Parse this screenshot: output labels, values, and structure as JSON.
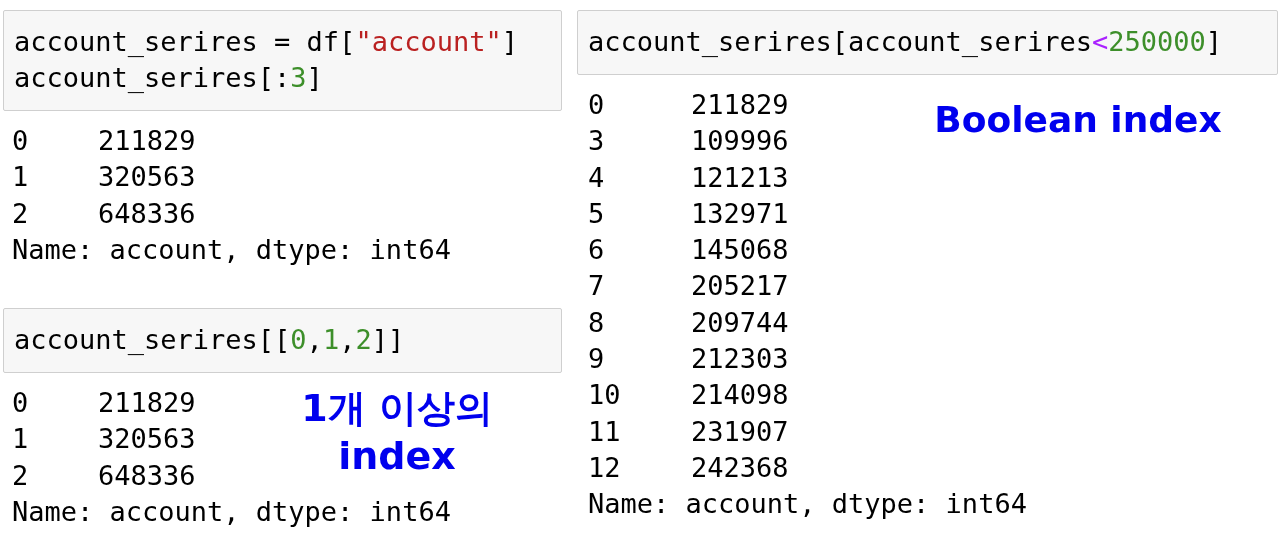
{
  "columns": [
    {
      "cells": [
        {
          "code": [
            [
              {
                "kind": "plain",
                "text": "account_serires = df["
              },
              {
                "kind": "string",
                "text": "\"account\""
              },
              {
                "kind": "plain",
                "text": "]"
              }
            ],
            [
              {
                "kind": "plain",
                "text": "account_serires[:"
              },
              {
                "kind": "number",
                "text": "3"
              },
              {
                "kind": "plain",
                "text": "]"
              }
            ]
          ],
          "output": {
            "rows": [
              {
                "index": "0",
                "value": "211829"
              },
              {
                "index": "1",
                "value": "320563"
              },
              {
                "index": "2",
                "value": "648336"
              }
            ],
            "footer": "Name: account, dtype: int64"
          }
        },
        {
          "code": [
            [
              {
                "kind": "plain",
                "text": "account_serires[["
              },
              {
                "kind": "number",
                "text": "0"
              },
              {
                "kind": "plain",
                "text": ","
              },
              {
                "kind": "number",
                "text": "1"
              },
              {
                "kind": "plain",
                "text": ","
              },
              {
                "kind": "number",
                "text": "2"
              },
              {
                "kind": "plain",
                "text": "]]"
              }
            ]
          ],
          "output": {
            "rows": [
              {
                "index": "0",
                "value": "211829"
              },
              {
                "index": "1",
                "value": "320563"
              },
              {
                "index": "2",
                "value": "648336"
              }
            ],
            "footer": "Name: account, dtype: int64"
          },
          "annotation": "1개 이상의 index"
        }
      ]
    },
    {
      "cells": [
        {
          "code": [
            [
              {
                "kind": "plain",
                "text": "account_serires[account_serires"
              },
              {
                "kind": "operator",
                "text": "<"
              },
              {
                "kind": "number",
                "text": "250000"
              },
              {
                "kind": "plain",
                "text": "]"
              }
            ]
          ],
          "output": {
            "rows": [
              {
                "index": "0",
                "value": "211829"
              },
              {
                "index": "3",
                "value": "109996"
              },
              {
                "index": "4",
                "value": "121213"
              },
              {
                "index": "5",
                "value": "132971"
              },
              {
                "index": "6",
                "value": "145068"
              },
              {
                "index": "7",
                "value": "205217"
              },
              {
                "index": "8",
                "value": "209744"
              },
              {
                "index": "9",
                "value": "212303"
              },
              {
                "index": "10",
                "value": "214098"
              },
              {
                "index": "11",
                "value": "231907"
              },
              {
                "index": "12",
                "value": "242368"
              }
            ],
            "footer": "Name: account, dtype: int64"
          },
          "annotation": "Boolean index"
        }
      ]
    }
  ]
}
